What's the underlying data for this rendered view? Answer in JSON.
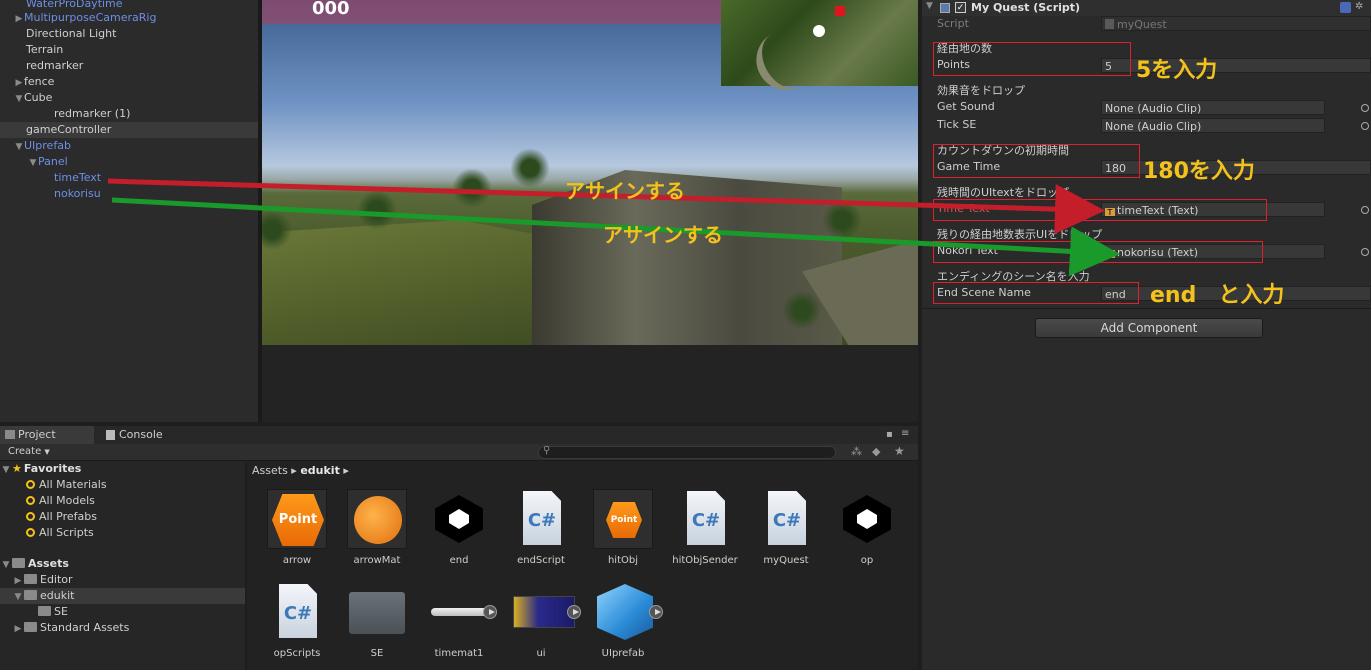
{
  "hierarchy": {
    "items": [
      {
        "label": "WaterProDaytime"
      },
      {
        "label": "MultipurposeCameraRig"
      },
      {
        "label": "Directional Light"
      },
      {
        "label": "Terrain"
      },
      {
        "label": "redmarker"
      },
      {
        "label": "fence"
      },
      {
        "label": "Cube"
      },
      {
        "label": "redmarker (1)"
      },
      {
        "label": "gameController"
      },
      {
        "label": "UIprefab"
      },
      {
        "label": "Panel"
      },
      {
        "label": "timeText"
      },
      {
        "label": "nokorisu"
      }
    ]
  },
  "scene": {
    "counter_text": "000"
  },
  "annotations": {
    "assign_1": "アサインする",
    "assign_2": "アサインする",
    "points_note": "5を入力",
    "time_note": "180を入力",
    "end_note": "end　と入力"
  },
  "inspector": {
    "component_title": "My Quest (Script)",
    "script_label": "Script",
    "script_value": "myQuest",
    "header_waypoints": "経由地の数",
    "points_label": "Points",
    "points_value": "5",
    "header_sound": "効果音をドロップ",
    "get_sound_label": "Get Sound",
    "get_sound_value": "None (Audio Clip)",
    "tick_se_label": "Tick SE",
    "tick_se_value": "None (Audio Clip)",
    "header_countdown": "カウントダウンの初期時間",
    "game_time_label": "Game Time",
    "game_time_value": "180",
    "header_time_ui": "残時間のUItextをドロップ",
    "time_text_label": "Time Text",
    "time_text_value": "timeText (Text)",
    "header_nokori_ui": "残りの経由地数表示UIをドロップ",
    "nokori_text_label": "Nokori Text",
    "nokori_text_value": "nokorisu (Text)",
    "header_end_scene": "エンディングのシーン名を入力",
    "end_scene_label": "End Scene Name",
    "end_scene_value": "end",
    "add_component_label": "Add Component"
  },
  "project": {
    "tab_project": "Project",
    "tab_console": "Console",
    "create_label": "Create",
    "favorites_label": "Favorites",
    "favorites": [
      "All Materials",
      "All Models",
      "All Prefabs",
      "All Scripts"
    ],
    "assets_label": "Assets",
    "folders": [
      "Editor",
      "edukit",
      "SE",
      "Standard Assets"
    ],
    "breadcrumb_root": "Assets",
    "breadcrumb_current": "edukit",
    "assets": [
      "arrow",
      "arrowMat",
      "end",
      "endScript",
      "hitObj",
      "hitObjSender",
      "myQuest",
      "op",
      "opScripts",
      "SE",
      "timemat1",
      "ui",
      "UIprefab"
    ],
    "point_text": "Point",
    "csharp_text": "C#"
  }
}
